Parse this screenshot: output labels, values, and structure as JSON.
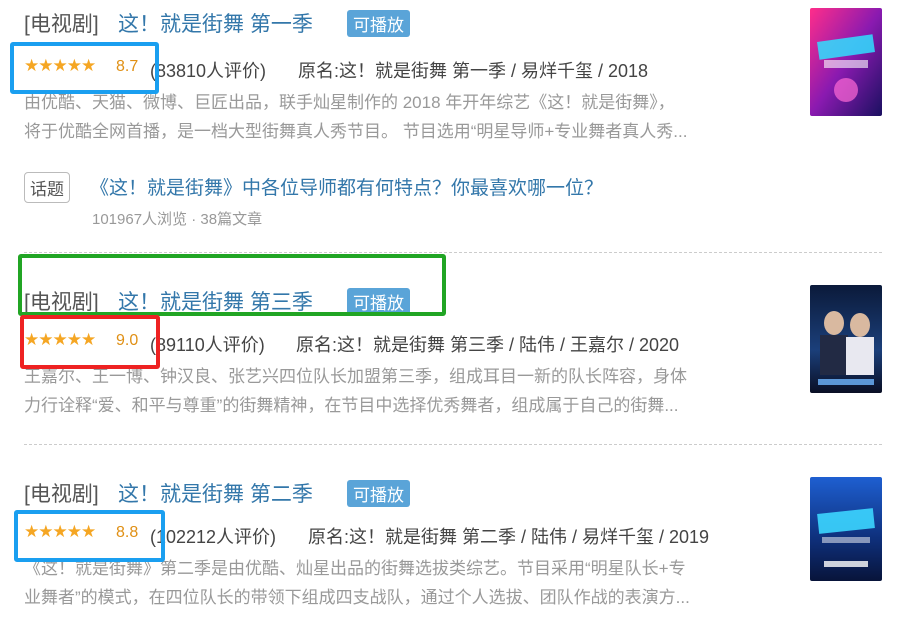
{
  "results": [
    {
      "category": "[电视剧]",
      "title": "这！就是街舞 第一季",
      "badge": "可播放",
      "score": "8.7",
      "rating_stars": 4.5,
      "votes": "(83810人评价)",
      "meta": "原名:这！就是街舞 第一季 / 易烊千玺 / 2018",
      "desc_line1": "由优酷、天猫、微博、巨匠出品，联手灿星制作的 2018 年开年综艺《这！就是街舞》，",
      "desc_line2": "将于优酷全网首播，是一档大型街舞真人秀节目。 节目选用“明星导师+专业舞者真人秀..."
    },
    {
      "category": "[电视剧]",
      "title": "这！就是街舞 第三季",
      "badge": "可播放",
      "score": "9.0",
      "rating_stars": 4.5,
      "votes": "(89110人评价)",
      "meta": "原名:这！就是街舞 第三季 / 陆伟 / 王嘉尔 / 2020",
      "desc_line1": "王嘉尔、王一博、钟汉良、张艺兴四位队长加盟第三季，组成耳目一新的队长阵容，身体",
      "desc_line2": "力行诠释“爱、和平与尊重”的街舞精神，在节目中选择优秀舞者，组成属于自己的街舞..."
    },
    {
      "category": "[电视剧]",
      "title": "这！就是街舞 第二季",
      "badge": "可播放",
      "score": "8.8",
      "rating_stars": 4.5,
      "votes": "(102212人评价)",
      "meta": "原名:这！就是街舞 第二季 / 陆伟 / 易烊千玺 / 2019",
      "desc_line1": "《这！就是街舞》第二季是由优酷、灿星出品的街舞选拔类综艺。节目采用“明星队长+专",
      "desc_line2": "业舞者”的模式，在四位队长的带领下组成四支战队，通过个人选拔、团队作战的表演方..."
    }
  ],
  "topic": {
    "tag": "话题",
    "link": "《这！就是街舞》中各位导师都有何特点？你最喜欢哪一位？",
    "stats": "101967人浏览 · 38篇文章"
  },
  "colors": {
    "blue_highlight": "#1a9ff0",
    "green_highlight": "#21a524",
    "red_highlight": "#ee2222"
  }
}
